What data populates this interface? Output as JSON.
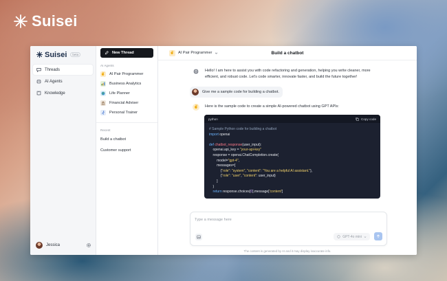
{
  "brand": {
    "name": "Suisei"
  },
  "sidebar": {
    "logo": "Suisei",
    "badge": "beta",
    "items": [
      {
        "label": "Threads",
        "icon": "chat-icon",
        "active": true
      },
      {
        "label": "AI Agents",
        "icon": "robot-icon",
        "active": false
      },
      {
        "label": "Knowledge",
        "icon": "book-icon",
        "active": false
      }
    ],
    "user": {
      "name": "Jessica"
    }
  },
  "agents": {
    "new_thread": "New Thread",
    "section_title": "AI Agents",
    "list": [
      {
        "label": "AI Pair Programmer",
        "icon": "peace-hand-icon",
        "color": "#fdecc8"
      },
      {
        "label": "Business Analytics",
        "icon": "chart-icon",
        "color": "#e6f0d8"
      },
      {
        "label": "Life Planner",
        "icon": "globe-icon",
        "color": "#dff0f7"
      },
      {
        "label": "Financial Adviser",
        "icon": "bank-icon",
        "color": "#eee6dc"
      },
      {
        "label": "Personal Trainer",
        "icon": "runner-icon",
        "color": "#e4ecf8"
      }
    ],
    "recent_title": "Recent",
    "recent": [
      {
        "label": "Build a chatbot"
      },
      {
        "label": "Customer support"
      }
    ]
  },
  "main": {
    "agent": "AI Pair Programmer",
    "title": "Build a chatbot",
    "welcome": "Hello! I am here to assist you with code refactoring and generation, helping you write cleaner, more efficient, and robust code. Let's code smarter, innovate faster, and build the future together!",
    "user_message": "Give me a sample code for building a chatbot.",
    "reply": "Here is the sample code to create a simple AI-powered chatbot using GPT APIs:",
    "code": {
      "language": "python",
      "copy_label": "Copy code",
      "comment": "# Sample Python code for building a chatbot",
      "l_import_kw": "import",
      "l_import_mod": " openai",
      "l_def_kw": "def",
      "l_def_fn": " chatbot_response",
      "l_def_args": "(user_input):",
      "l_key_a": "    openai.api_key = ",
      "l_key_str": "\"your-api-key\"",
      "l_resp": "    response = openai.ChatCompletion.create(",
      "l_model_a": "        model=",
      "l_model_str": "\"gpt-4\"",
      "l_model_end": ",",
      "l_msgs": "        messages=[",
      "l_sys_a": "            {",
      "l_sys_k1": "\"role\"",
      "l_sys_m1": ": ",
      "l_sys_v1": "\"system\"",
      "l_sys_m2": ", ",
      "l_sys_k2": "\"content\"",
      "l_sys_m3": ": ",
      "l_sys_v2": "\"You are a helpful AI assistant.\"",
      "l_sys_end": "},",
      "l_usr_a": "            {",
      "l_usr_k1": "\"role\"",
      "l_usr_m1": ": ",
      "l_usr_v1": "\"user\"",
      "l_usr_m2": ", ",
      "l_usr_k2": "\"content\"",
      "l_usr_end": ": user_input}",
      "l_close1": "        ]",
      "l_close2": "    )",
      "l_ret_kw": "    return",
      "l_ret_a": " response.choices[",
      "l_ret_num": "0",
      "l_ret_b": "].message[",
      "l_ret_str": "'content'",
      "l_ret_c": "]"
    },
    "composer": {
      "placeholder": "Type a message here",
      "model": "GPT-4o mini"
    },
    "disclaimer": "The content is generated by AI and it may display inaccurate info."
  },
  "colors": {
    "accent": "#15181d",
    "send": "#a9c5f0",
    "code_bg": "#1c2130"
  }
}
